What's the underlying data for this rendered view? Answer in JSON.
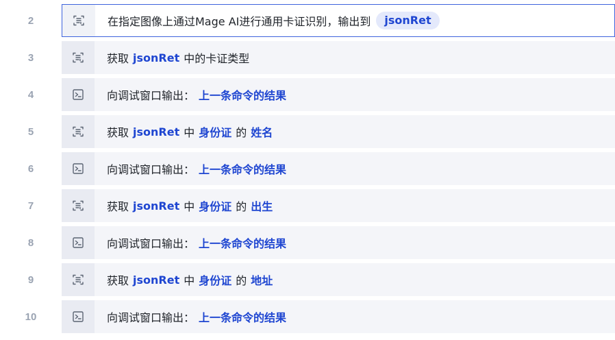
{
  "steps": [
    {
      "line": "2",
      "icon": "ocr-scan-icon",
      "selected": true,
      "parts": [
        {
          "text": "在指定图像上通过Mage AI进行通用卡证识别，输出到",
          "kind": "text"
        },
        {
          "text": "jsonRet",
          "kind": "pill"
        }
      ]
    },
    {
      "line": "3",
      "icon": "ocr-scan-icon",
      "selected": false,
      "parts": [
        {
          "text": "获取",
          "kind": "text"
        },
        {
          "text": "jsonRet",
          "kind": "value"
        },
        {
          "text": "中的卡证类型",
          "kind": "text"
        }
      ]
    },
    {
      "line": "4",
      "icon": "terminal-icon",
      "selected": false,
      "parts": [
        {
          "text": "向调试窗口输出：",
          "kind": "text"
        },
        {
          "text": "上一条命令的结果",
          "kind": "value"
        }
      ]
    },
    {
      "line": "5",
      "icon": "ocr-scan-icon",
      "selected": false,
      "parts": [
        {
          "text": "获取",
          "kind": "text"
        },
        {
          "text": "jsonRet",
          "kind": "value"
        },
        {
          "text": "中",
          "kind": "text"
        },
        {
          "text": "身份证",
          "kind": "value"
        },
        {
          "text": "的",
          "kind": "text"
        },
        {
          "text": "姓名",
          "kind": "value"
        }
      ]
    },
    {
      "line": "6",
      "icon": "terminal-icon",
      "selected": false,
      "parts": [
        {
          "text": "向调试窗口输出：",
          "kind": "text"
        },
        {
          "text": "上一条命令的结果",
          "kind": "value"
        }
      ]
    },
    {
      "line": "7",
      "icon": "ocr-scan-icon",
      "selected": false,
      "parts": [
        {
          "text": "获取",
          "kind": "text"
        },
        {
          "text": "jsonRet",
          "kind": "value"
        },
        {
          "text": "中",
          "kind": "text"
        },
        {
          "text": "身份证",
          "kind": "value"
        },
        {
          "text": "的",
          "kind": "text"
        },
        {
          "text": "出生",
          "kind": "value"
        }
      ]
    },
    {
      "line": "8",
      "icon": "terminal-icon",
      "selected": false,
      "parts": [
        {
          "text": "向调试窗口输出：",
          "kind": "text"
        },
        {
          "text": "上一条命令的结果",
          "kind": "value"
        }
      ]
    },
    {
      "line": "9",
      "icon": "ocr-scan-icon",
      "selected": false,
      "parts": [
        {
          "text": "获取",
          "kind": "text"
        },
        {
          "text": "jsonRet",
          "kind": "value"
        },
        {
          "text": "中",
          "kind": "text"
        },
        {
          "text": "身份证",
          "kind": "value"
        },
        {
          "text": "的",
          "kind": "text"
        },
        {
          "text": "地址",
          "kind": "value"
        }
      ]
    },
    {
      "line": "10",
      "icon": "terminal-icon",
      "selected": false,
      "parts": [
        {
          "text": "向调试窗口输出：",
          "kind": "text"
        },
        {
          "text": "上一条命令的结果",
          "kind": "value"
        }
      ]
    }
  ],
  "colors": {
    "value_text": "#1f46d1",
    "line_number": "#9aa3b2",
    "row_background": "#f4f5f9",
    "selected_border": "#3d63dd"
  }
}
